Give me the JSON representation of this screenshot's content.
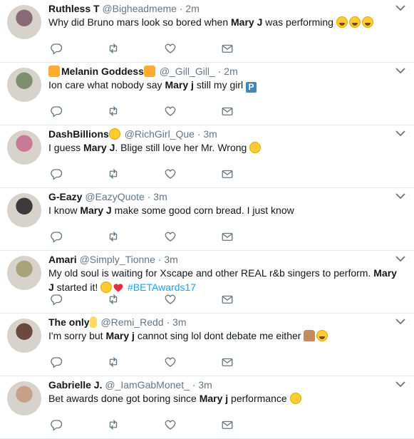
{
  "tweets": [
    {
      "name": "Ruthless T",
      "handle": "@Bigheadmeme",
      "time": "2m",
      "name_emoji_after": [],
      "text_parts": [
        {
          "t": "Why did Bruno mars look so bored when "
        },
        {
          "t": "Mary J",
          "bold": true
        },
        {
          "t": " was performing "
        },
        {
          "emoji": "laugh"
        },
        {
          "emoji": "laugh"
        },
        {
          "emoji": "laugh"
        }
      ],
      "avatar_color": "#8a6a74"
    },
    {
      "name": "Melanin Goddess",
      "handle": "@_Gill_Gill_",
      "time": "2m",
      "name_emoji_before": "star",
      "name_emoji_after": "star",
      "text_parts": [
        {
          "t": "Ion care what nobody say "
        },
        {
          "t": "Mary j",
          "bold": true
        },
        {
          "t": " still my girl "
        },
        {
          "emoji": "parking",
          "label": "P"
        }
      ],
      "avatar_color": "#7d8f6e"
    },
    {
      "name": "DashBillions",
      "handle": "@RichGirl_Que",
      "time": "3m",
      "name_emoji_after": "money",
      "text_parts": [
        {
          "t": "I guess "
        },
        {
          "t": "Mary J",
          "bold": true
        },
        {
          "t": ". Blige still love her Mr. Wrong "
        },
        {
          "emoji": "tired"
        }
      ],
      "avatar_color": "#c97a96"
    },
    {
      "name": "G-Eazy",
      "handle": "@EazyQuote",
      "time": "3m",
      "text_parts": [
        {
          "t": "I know "
        },
        {
          "t": "Mary J",
          "bold": true
        },
        {
          "t": " make some good corn bread. I just know"
        }
      ],
      "avatar_color": "#3a3a3a"
    },
    {
      "name": "Amari",
      "handle": "@Simply_Tionne",
      "time": "3m",
      "text_parts": [
        {
          "t": "My old soul is waiting for Xscape and other REAL r&b singers to perform. "
        },
        {
          "t": "Mary J",
          "bold": true
        },
        {
          "t": " started it! "
        },
        {
          "emoji": "tired"
        },
        {
          "emoji": "heart"
        },
        {
          "t": " "
        },
        {
          "t": "#BETAwards17",
          "hashtag": true
        }
      ],
      "avatar_color": "#a9a37a"
    },
    {
      "name": "The only",
      "handle": "@Remi_Redd",
      "time": "3m",
      "name_emoji_after": "hand",
      "text_parts": [
        {
          "t": "I'm sorry but "
        },
        {
          "t": "Mary j",
          "bold": true
        },
        {
          "t": " cannot sing lol dont debate me either "
        },
        {
          "emoji": "woman"
        },
        {
          "emoji": "laugh"
        }
      ],
      "avatar_color": "#6b4a3e"
    },
    {
      "name": "Gabrielle J.",
      "handle": "@_IamGabMonet_",
      "time": "3m",
      "text_parts": [
        {
          "t": "Bet awards done got boring since "
        },
        {
          "t": "Mary j",
          "bold": true
        },
        {
          "t": " performance "
        },
        {
          "emoji": "eyeroll"
        }
      ],
      "avatar_color": "#c9a08a"
    }
  ],
  "actions": {
    "reply_icon": "reply-icon",
    "retweet_icon": "retweet-icon",
    "like_icon": "heart-icon",
    "message_icon": "envelope-icon"
  },
  "colors": {
    "icon_gray": "#657786",
    "hashtag_blue": "#1da1f2",
    "divider": "#e6ecf0"
  }
}
